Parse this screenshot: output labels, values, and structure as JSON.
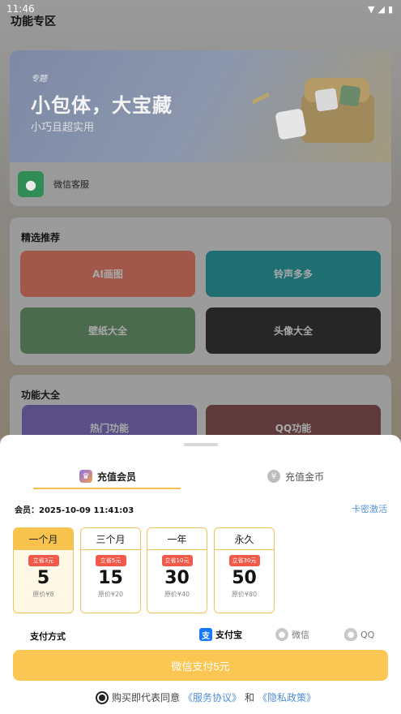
{
  "status_bar": {
    "time": "11:46",
    "icons": [
      "wifi-icon",
      "signal-icon",
      "battery-icon"
    ]
  },
  "page": {
    "title": "功能专区"
  },
  "banner": {
    "tag": "专题",
    "title": "小包体，大宝藏",
    "subtitle": "小巧且超实用",
    "service_label": "微信客服"
  },
  "featured": {
    "title": "精选推荐",
    "tiles": [
      {
        "label": "AI画图",
        "color": "#a1584a"
      },
      {
        "label": "铃声多多",
        "color": "#1f6f72"
      },
      {
        "label": "壁纸大全",
        "color": "#4c6b4e"
      },
      {
        "label": "头像大全",
        "color": "#262626"
      }
    ]
  },
  "functions": {
    "title": "功能大全",
    "tiles": [
      {
        "label": "热门功能",
        "color": "#5a4e86"
      },
      {
        "label": "QQ功能",
        "color": "#5e3b3a"
      }
    ]
  },
  "sheet": {
    "tabs": [
      {
        "label": "充值会员",
        "active": true
      },
      {
        "label": "充值金币",
        "active": false
      }
    ],
    "member_label": "会员：",
    "member_expiry": "2025-10-09 11:41:03",
    "card_activate": "卡密激活",
    "plans": [
      {
        "name": "一个月",
        "badge": "立省3元",
        "price": "5",
        "original": "原价¥8",
        "selected": true
      },
      {
        "name": "三个月",
        "badge": "立省5元",
        "price": "15",
        "original": "原价¥20",
        "selected": false
      },
      {
        "name": "一年",
        "badge": "立省10元",
        "price": "30",
        "original": "原价¥40",
        "selected": false
      },
      {
        "name": "永久",
        "badge": "立省30元",
        "price": "50",
        "original": "原价¥80",
        "selected": false
      }
    ],
    "payment": {
      "label": "支付方式",
      "options": [
        {
          "label": "支付宝",
          "icon": "alipay-icon",
          "selected": true
        },
        {
          "label": "微信",
          "icon": "wechat-icon",
          "selected": false
        },
        {
          "label": "QQ",
          "icon": "qq-icon",
          "selected": false
        }
      ]
    },
    "pay_button": "微信支付5元",
    "agreement": {
      "prefix": "购买即代表同意",
      "service": "《服务协议》",
      "and": "和",
      "privacy": "《隐私政策》"
    }
  },
  "colors": {
    "accent": "#fbc651",
    "link": "#4f8dd6",
    "badge": "#f15a4a"
  }
}
